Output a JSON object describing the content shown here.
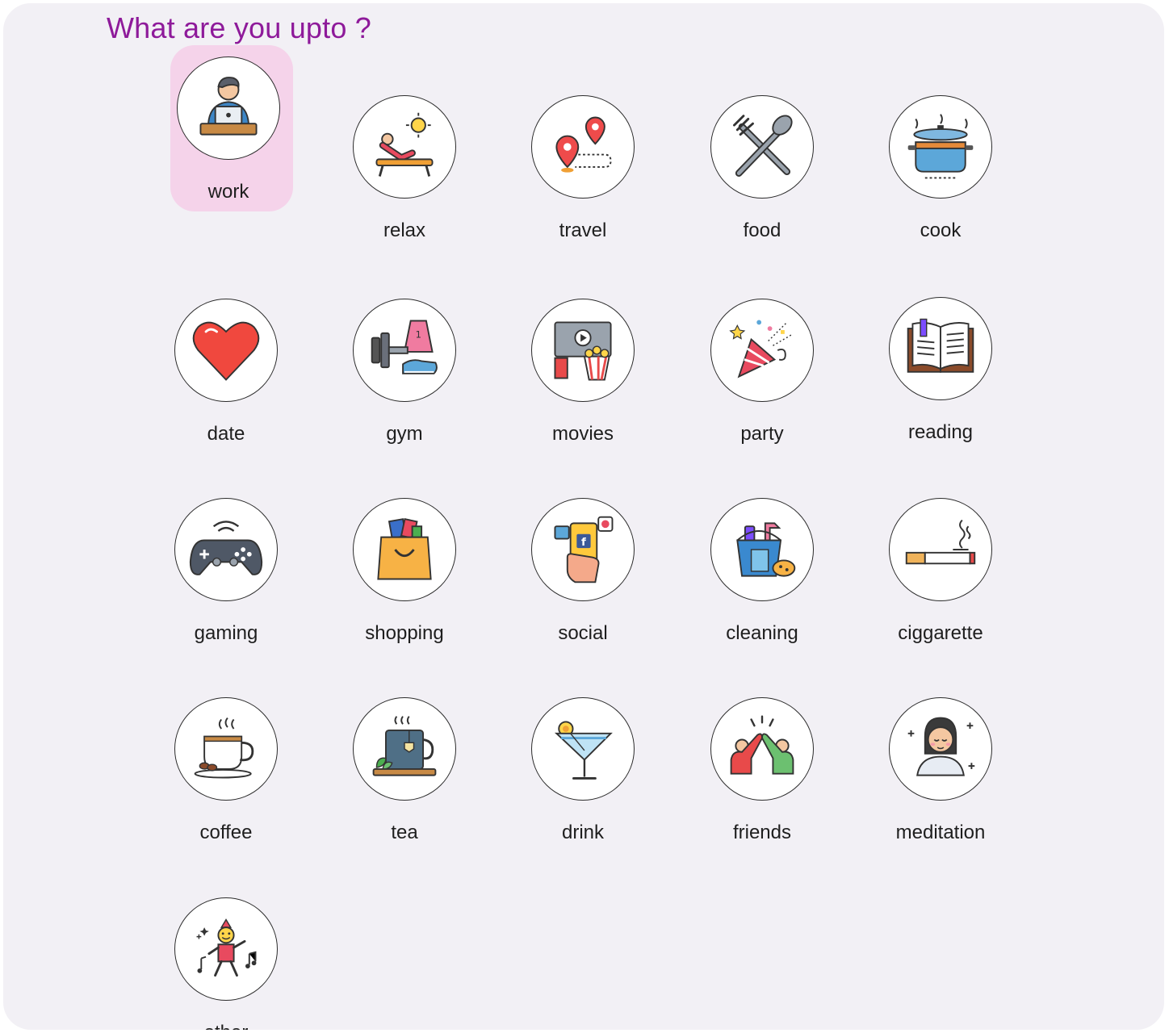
{
  "title": "What are you upto ?",
  "colors": {
    "title": "#8e1a9a",
    "selected_bg": "#f5d3ea",
    "panel_bg": "#f2f0f5"
  },
  "activities": [
    {
      "label": "work",
      "icon": "work-laptop-icon",
      "selected": true
    },
    {
      "label": "relax",
      "icon": "sunbed-icon"
    },
    {
      "label": "travel",
      "icon": "map-pins-icon"
    },
    {
      "label": "food",
      "icon": "fork-spoon-icon"
    },
    {
      "label": "cook",
      "icon": "cooking-pot-icon"
    },
    {
      "label": "date",
      "icon": "heart-icon"
    },
    {
      "label": "gym",
      "icon": "dumbbell-icon"
    },
    {
      "label": "movies",
      "icon": "cinema-popcorn-icon"
    },
    {
      "label": "party",
      "icon": "party-popper-icon"
    },
    {
      "label": "reading",
      "icon": "open-book-icon"
    },
    {
      "label": "gaming",
      "icon": "gamepad-icon"
    },
    {
      "label": "shopping",
      "icon": "shopping-bag-icon"
    },
    {
      "label": "social",
      "icon": "phone-social-icon"
    },
    {
      "label": "cleaning",
      "icon": "cleaning-bucket-icon"
    },
    {
      "label": "ciggarette",
      "icon": "cigarette-icon"
    },
    {
      "label": "coffee",
      "icon": "coffee-cup-icon"
    },
    {
      "label": "tea",
      "icon": "tea-mug-icon"
    },
    {
      "label": "drink",
      "icon": "cocktail-icon"
    },
    {
      "label": "friends",
      "icon": "high-five-icon"
    },
    {
      "label": "meditation",
      "icon": "meditation-icon"
    },
    {
      "label": "other",
      "icon": "dancing-person-icon"
    }
  ]
}
